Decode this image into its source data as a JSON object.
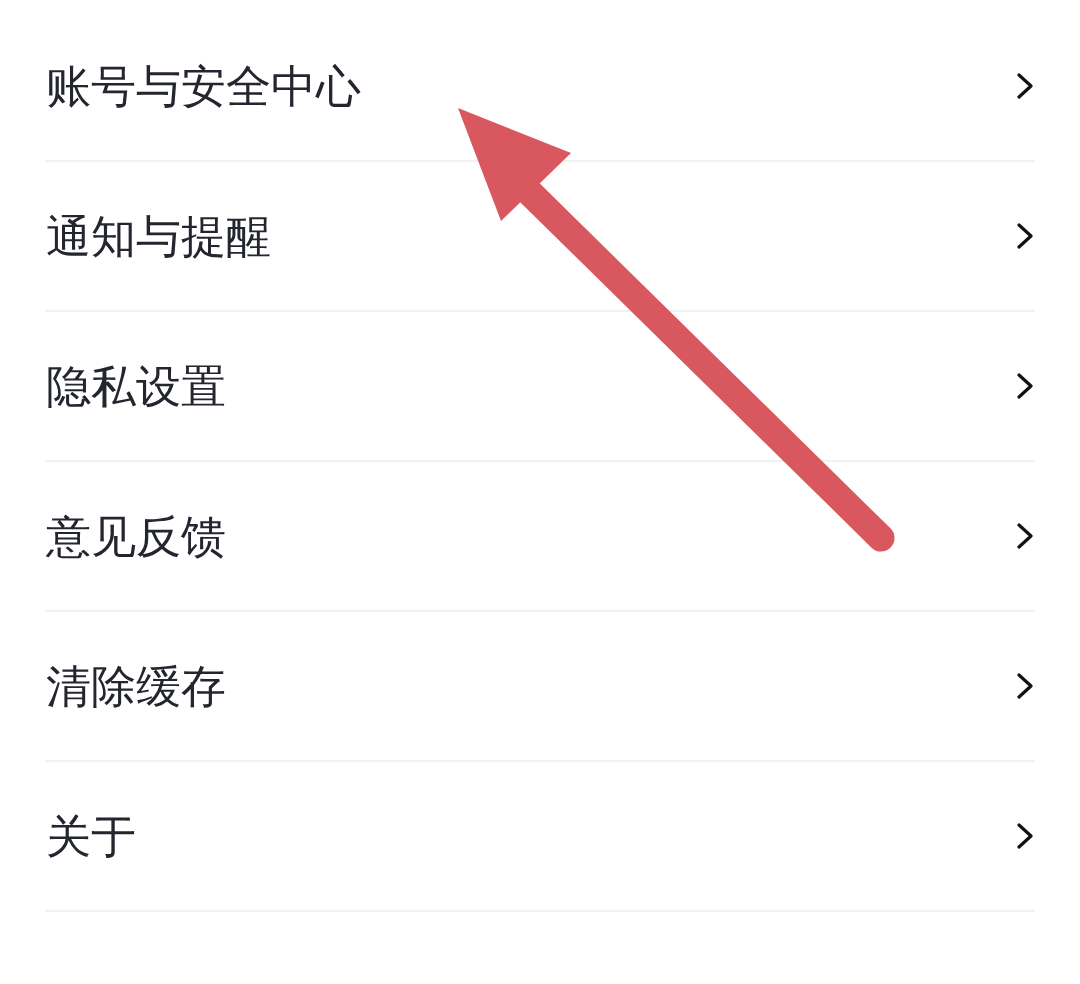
{
  "settings_list": {
    "items": [
      {
        "label": "账号与安全中心"
      },
      {
        "label": "通知与提醒"
      },
      {
        "label": "隐私设置"
      },
      {
        "label": "意见反馈"
      },
      {
        "label": "清除缓存"
      },
      {
        "label": "关于"
      }
    ]
  }
}
